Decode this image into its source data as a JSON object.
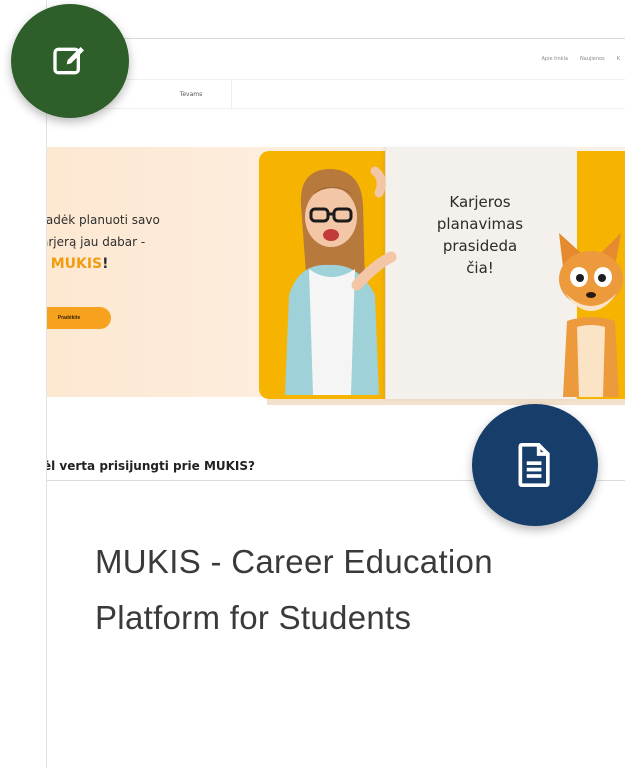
{
  "embedded_page": {
    "nav_items": [
      "Apie tinkla",
      "Naujienos",
      "K"
    ],
    "tab_label": "Tevams",
    "hero": {
      "line1": "radėk planuoti savo",
      "line2": "arjerą jau dabar -",
      "brand_prefix": "ı ",
      "brand": "MUKIS",
      "brand_suffix": "!",
      "cta_label": "Pradėkite"
    },
    "panel_text_1": "Karjeros",
    "panel_text_2": "planavimas",
    "panel_text_3": "prasideda",
    "panel_text_4": "čia!",
    "question": "ėl verta prisijungti prie MUKIS?"
  },
  "card": {
    "title_line1": "MUKIS - Career Education",
    "title_line2": "Platform for Students"
  },
  "icons": {
    "edit_badge": "edit-icon",
    "document_badge": "document-icon"
  },
  "colors": {
    "edit_badge": "#2e5f2b",
    "document_badge": "#173e6a",
    "accent_orange": "#f39c12",
    "panel_yellow": "#f6b400"
  }
}
